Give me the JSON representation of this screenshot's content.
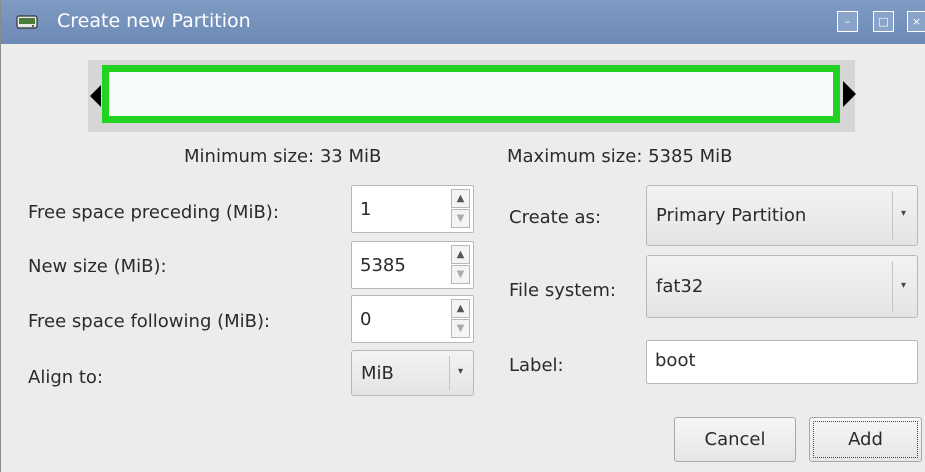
{
  "window": {
    "title": "Create new Partition",
    "controls": {
      "minimize": "–",
      "maximize": "□",
      "close": "×"
    }
  },
  "partition_graphic": {
    "fill_color": "#21d221"
  },
  "sizes": {
    "minimum": "Minimum size: 33 MiB",
    "maximum": "Maximum size: 5385 MiB"
  },
  "left_form": {
    "free_preceding": {
      "label": "Free space preceding (MiB):",
      "value": "1"
    },
    "new_size": {
      "label": "New size (MiB):",
      "value": "5385"
    },
    "free_following": {
      "label": "Free space following (MiB):",
      "value": "0"
    },
    "align_to": {
      "label": "Align to:",
      "value": "MiB"
    }
  },
  "right_form": {
    "create_as": {
      "label": "Create as:",
      "value": "Primary Partition"
    },
    "file_system": {
      "label": "File system:",
      "value": "fat32"
    },
    "label": {
      "label": "Label:",
      "value": "boot"
    }
  },
  "buttons": {
    "cancel": "Cancel",
    "add": "Add"
  },
  "icons": {
    "up": "▲",
    "down": "▼",
    "caret": "▾"
  }
}
